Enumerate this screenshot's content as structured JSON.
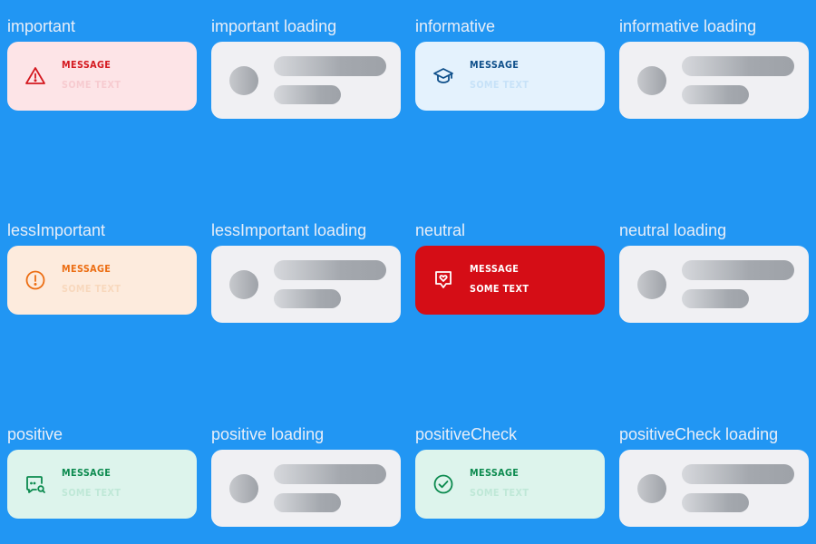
{
  "cells": [
    {
      "title": "important",
      "message": "MESSAGE",
      "text": "SOME TEXT",
      "icon": "warning-triangle-icon",
      "bg": "#fde4e7",
      "fg": "#d4181f",
      "sub": "#f7cbd0"
    },
    {
      "title": "important loading"
    },
    {
      "title": "informative",
      "message": "MESSAGE",
      "text": "SOME TEXT",
      "icon": "graduation-cap-icon",
      "bg": "#e4f2fd",
      "fg": "#0e4f8a",
      "sub": "#c7e2f8"
    },
    {
      "title": "informative loading"
    },
    {
      "title": "lessImportant",
      "message": "MESSAGE",
      "text": "SOME TEXT",
      "icon": "exclamation-circle-icon",
      "bg": "#fdebdd",
      "fg": "#ec6d12",
      "sub": "#f8d8bd"
    },
    {
      "title": "lessImportant loading"
    },
    {
      "title": "neutral",
      "message": "MESSAGE",
      "text": "SOME TEXT",
      "icon": "heart-shield-icon",
      "bg": "#d50d16",
      "fg": "#ffffff",
      "sub": "#ffffff"
    },
    {
      "title": "neutral loading"
    },
    {
      "title": "positive",
      "message": "MESSAGE",
      "text": "SOME TEXT",
      "icon": "chat-search-icon",
      "bg": "#ddf4ec",
      "fg": "#0b8a4e",
      "sub": "#bfe8d7"
    },
    {
      "title": "positive loading"
    },
    {
      "title": "positiveCheck",
      "message": "MESSAGE",
      "text": "SOME TEXT",
      "icon": "check-circle-icon",
      "bg": "#ddf4ec",
      "fg": "#0b8a4e",
      "sub": "#bfe8d7"
    },
    {
      "title": "positiveCheck loading"
    }
  ],
  "colors": {
    "page_bg": "#2196f3",
    "skeleton_bg": "#f0f0f3"
  }
}
